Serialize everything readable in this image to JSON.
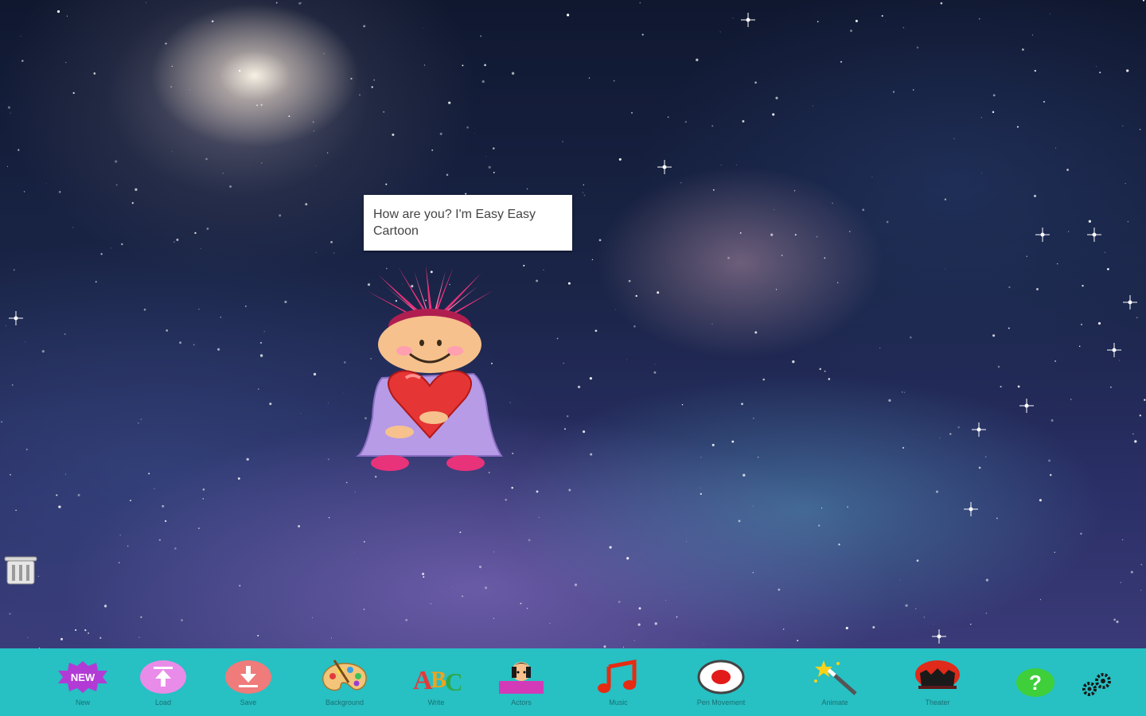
{
  "scene": {
    "speech_text": "How are you? I'm Easy Easy Cartoon"
  },
  "toolbar": {
    "items": [
      {
        "label": "New",
        "icon": "new-badge-icon"
      },
      {
        "label": "Load",
        "icon": "upload-icon"
      },
      {
        "label": "Save",
        "icon": "download-icon"
      },
      {
        "label": "Background",
        "icon": "palette-icon"
      },
      {
        "label": "Write",
        "icon": "abc-icon"
      },
      {
        "label": "Actors",
        "icon": "actors-icon"
      },
      {
        "label": "Music",
        "icon": "music-note-icon"
      },
      {
        "label": "Pen Movement",
        "icon": "record-icon"
      },
      {
        "label": "Animate",
        "icon": "magic-wand-icon"
      },
      {
        "label": "Theater",
        "icon": "theater-icon"
      }
    ],
    "help_icon": "help-icon",
    "settings_icon": "gears-icon"
  },
  "colors": {
    "toolbar_bg": "#27c0c3",
    "new_badge": "#b23bd6",
    "load_circle": "#e98be8",
    "save_circle": "#ef7b7b",
    "help": "#3ecf3a"
  }
}
